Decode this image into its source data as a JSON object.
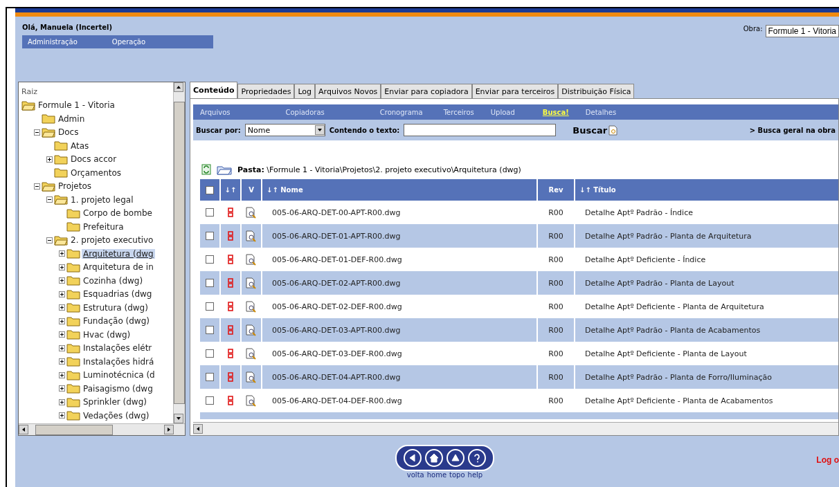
{
  "header": {
    "greeting": "Olá, Manuela (Incertel)",
    "menu": [
      {
        "label": "Administração"
      },
      {
        "label": "Operação"
      }
    ],
    "project_label": "Obra:",
    "project_value": "Formule 1 - Vitoria"
  },
  "tree": {
    "root_label": "Raiz",
    "items": [
      {
        "label": "Formule 1 - Vitoria",
        "selected": false,
        "children": [
          {
            "label": "Admin",
            "selected": false
          },
          {
            "label": "Docs",
            "selected": false,
            "expanded": true,
            "children": [
              {
                "label": "Atas",
                "selected": false
              },
              {
                "label": "Docs accor",
                "selected": false,
                "expanded": false
              },
              {
                "label": "Orçamentos",
                "selected": false
              }
            ]
          },
          {
            "label": "Projetos",
            "selected": false,
            "expanded": true,
            "children": [
              {
                "label": "1. projeto legal",
                "selected": false,
                "expanded": true,
                "children": [
                  {
                    "label": "Corpo de bombe",
                    "selected": false
                  },
                  {
                    "label": "Prefeitura",
                    "selected": false
                  }
                ]
              },
              {
                "label": "2. projeto executivo",
                "selected": false,
                "expanded": true,
                "children": [
                  {
                    "label": "Arquitetura (dwg",
                    "selected": true,
                    "expanded": false
                  },
                  {
                    "label": "Arquitetura de in",
                    "selected": false,
                    "expanded": false
                  },
                  {
                    "label": "Cozinha (dwg)",
                    "selected": false,
                    "expanded": false
                  },
                  {
                    "label": "Esquadrias (dwg",
                    "selected": false,
                    "expanded": false
                  },
                  {
                    "label": "Estrutura (dwg)",
                    "selected": false,
                    "expanded": false
                  },
                  {
                    "label": "Fundação (dwg)",
                    "selected": false,
                    "expanded": false
                  },
                  {
                    "label": "Hvac (dwg)",
                    "selected": false,
                    "expanded": false
                  },
                  {
                    "label": "Instalações elétr",
                    "selected": false,
                    "expanded": false
                  },
                  {
                    "label": "Instalações hidrá",
                    "selected": false,
                    "expanded": false
                  },
                  {
                    "label": "Luminotécnica (d",
                    "selected": false,
                    "expanded": false
                  },
                  {
                    "label": "Paisagismo (dwg",
                    "selected": false,
                    "expanded": false
                  },
                  {
                    "label": "Sprinkler (dwg)",
                    "selected": false,
                    "expanded": false
                  },
                  {
                    "label": "Vedações (dwg)",
                    "selected": false,
                    "expanded": false
                  }
                ]
              }
            ]
          }
        ]
      }
    ]
  },
  "tabs": [
    {
      "label": "Conteúdo",
      "selected": true
    },
    {
      "label": "Propriedades",
      "selected": false
    },
    {
      "label": "Log",
      "selected": false
    },
    {
      "label": "Arquivos Novos",
      "selected": false
    },
    {
      "label": "Enviar para copiadora",
      "selected": false
    },
    {
      "label": "Enviar para terceiros",
      "selected": false
    },
    {
      "label": "Distribuição Física",
      "selected": false
    }
  ],
  "subnav": [
    {
      "label": "Arquivos",
      "selected": false
    },
    {
      "label": "Copiadoras",
      "selected": false
    },
    {
      "label": "Cronograma",
      "selected": false
    },
    {
      "label": "Terceiros",
      "selected": false
    },
    {
      "label": "Upload",
      "selected": false
    },
    {
      "label": "Busca!",
      "selected": true
    },
    {
      "label": "Detalhes",
      "selected": false
    }
  ],
  "search": {
    "by_label": "Buscar por:",
    "by_value": "Nome",
    "text_label": "Contendo o texto:",
    "button": "Buscar",
    "global_link": "> Busca geral na obra"
  },
  "path": {
    "label": "Pasta:",
    "value": "\\Formule 1 - Vitoria\\Projetos\\2. projeto executivo\\Arquitetura (dwg)"
  },
  "table": {
    "columns": [
      {
        "kind": "checkbox",
        "checked": false
      },
      {
        "kind": "text",
        "label": "↓↑"
      },
      {
        "kind": "text",
        "label": "V"
      },
      {
        "kind": "text",
        "label": "↓↑ Nome"
      },
      {
        "kind": "text",
        "label": "Rev"
      },
      {
        "kind": "text",
        "label": "↓↑ Título"
      }
    ],
    "rows": [
      {
        "checked": false,
        "name": "005-06-ARQ-DET-00-APT-R00.dwg",
        "rev": "R00",
        "title": "Detalhe Aptº Padrão - Índice"
      },
      {
        "checked": false,
        "name": "005-06-ARQ-DET-01-APT-R00.dwg",
        "rev": "R00",
        "title": "Detalhe Aptº Padrão - Planta de Arquitetura"
      },
      {
        "checked": false,
        "name": "005-06-ARQ-DET-01-DEF-R00.dwg",
        "rev": "R00",
        "title": "Detalhe Aptº Deficiente - Índice"
      },
      {
        "checked": false,
        "name": "005-06-ARQ-DET-02-APT-R00.dwg",
        "rev": "R00",
        "title": "Detalhe Aptº Padrão - Planta de Layout"
      },
      {
        "checked": false,
        "name": "005-06-ARQ-DET-02-DEF-R00.dwg",
        "rev": "R00",
        "title": "Detalhe Aptº Deficiente - Planta de Arquitetura"
      },
      {
        "checked": false,
        "name": "005-06-ARQ-DET-03-APT-R00.dwg",
        "rev": "R00",
        "title": "Detalhe Aptº Padrão - Planta de Acabamentos"
      },
      {
        "checked": false,
        "name": "005-06-ARQ-DET-03-DEF-R00.dwg",
        "rev": "R00",
        "title": "Detalhe Aptº Deficiente - Planta de Layout"
      },
      {
        "checked": false,
        "name": "005-06-ARQ-DET-04-APT-R00.dwg",
        "rev": "R00",
        "title": "Detalhe Aptº Padrão - Planta de Forro/Iluminação"
      },
      {
        "checked": false,
        "name": "005-06-ARQ-DET-04-DEF-R00.dwg",
        "rev": "R00",
        "title": "Detalhe Aptº Deficiente - Planta de Acabamentos"
      }
    ]
  },
  "footer": {
    "nav": [
      {
        "kind": "back",
        "label": "volta"
      },
      {
        "kind": "home",
        "label": "home"
      },
      {
        "kind": "top",
        "label": "topo"
      },
      {
        "kind": "help",
        "label": "help"
      }
    ],
    "logout": "Log o"
  }
}
